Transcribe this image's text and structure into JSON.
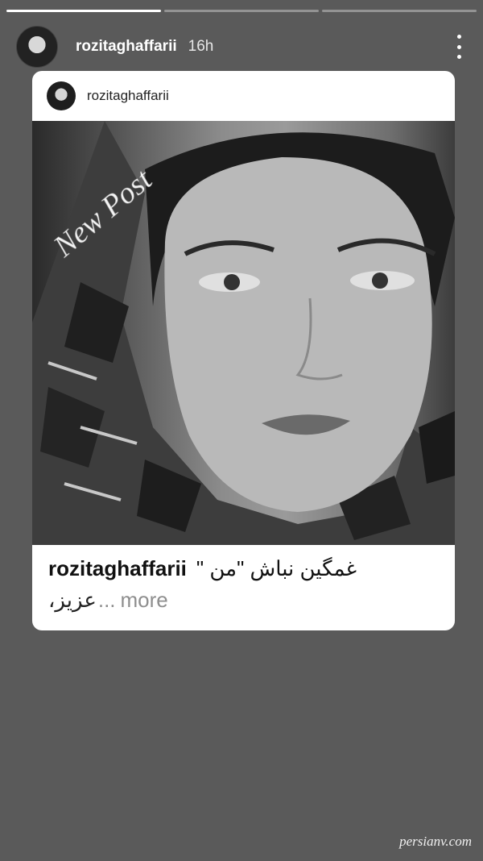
{
  "story": {
    "username": "rozitaghaffarii",
    "time": "16h"
  },
  "post": {
    "username": "rozitaghaffarii",
    "overlay_text": "New Post",
    "caption_username": "rozitaghaffarii",
    "caption_text": "غمگین نباش \"من \"",
    "caption_second": "عزیز،",
    "caption_more_prefix": "...",
    "caption_more": "more"
  },
  "watermark": "persianv.com",
  "icons": {
    "menu": "more-vertical-icon"
  }
}
